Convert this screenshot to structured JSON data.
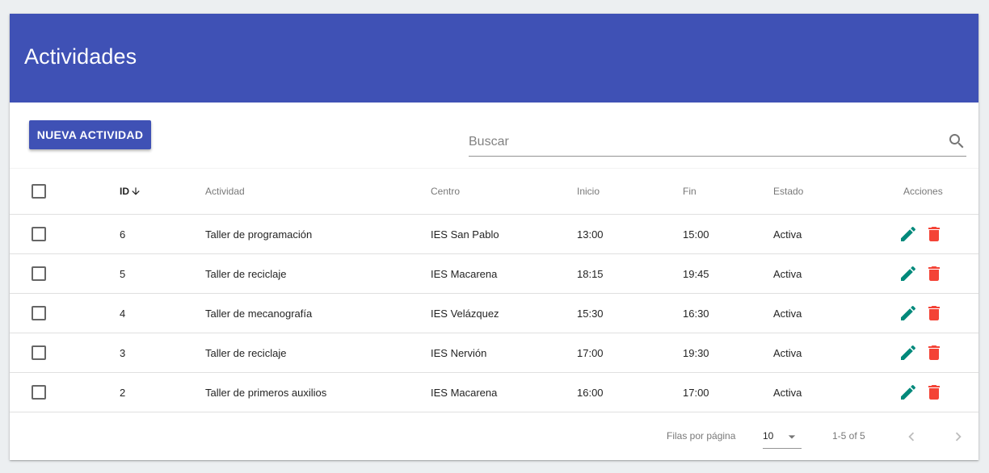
{
  "page": {
    "title": "Actividades"
  },
  "toolbar": {
    "new_button_label": "NUEVA ACTIVIDAD",
    "search_placeholder": "Buscar",
    "search_value": ""
  },
  "table": {
    "columns": {
      "id": "ID",
      "actividad": "Actividad",
      "centro": "Centro",
      "inicio": "Inicio",
      "fin": "Fin",
      "estado": "Estado",
      "acciones": "Acciones"
    },
    "sort": {
      "column": "id",
      "direction": "desc",
      "icon": "arrow-down-icon"
    },
    "rows": [
      {
        "id": "6",
        "actividad": "Taller de programación",
        "centro": "IES San Pablo",
        "inicio": "13:00",
        "fin": "15:00",
        "estado": "Activa"
      },
      {
        "id": "5",
        "actividad": "Taller de reciclaje",
        "centro": "IES Macarena",
        "inicio": "18:15",
        "fin": "19:45",
        "estado": "Activa"
      },
      {
        "id": "4",
        "actividad": "Taller de mecanografía",
        "centro": "IES Velázquez",
        "inicio": "15:30",
        "fin": "16:30",
        "estado": "Activa"
      },
      {
        "id": "3",
        "actividad": "Taller de reciclaje",
        "centro": "IES Nervión",
        "inicio": "17:00",
        "fin": "19:30",
        "estado": "Activa"
      },
      {
        "id": "2",
        "actividad": "Taller de primeros auxilios",
        "centro": "IES Macarena",
        "inicio": "16:00",
        "fin": "17:00",
        "estado": "Activa"
      }
    ],
    "action_icons": {
      "edit": "pencil-icon",
      "delete": "trash-icon"
    }
  },
  "pagination": {
    "rows_per_page_label": "Filas por página",
    "rows_per_page_value": "10",
    "range_label": "1-5 of 5"
  },
  "colors": {
    "primary": "#3f51b5",
    "edit": "#00897b",
    "delete": "#f44336",
    "background": "#eceff1"
  }
}
